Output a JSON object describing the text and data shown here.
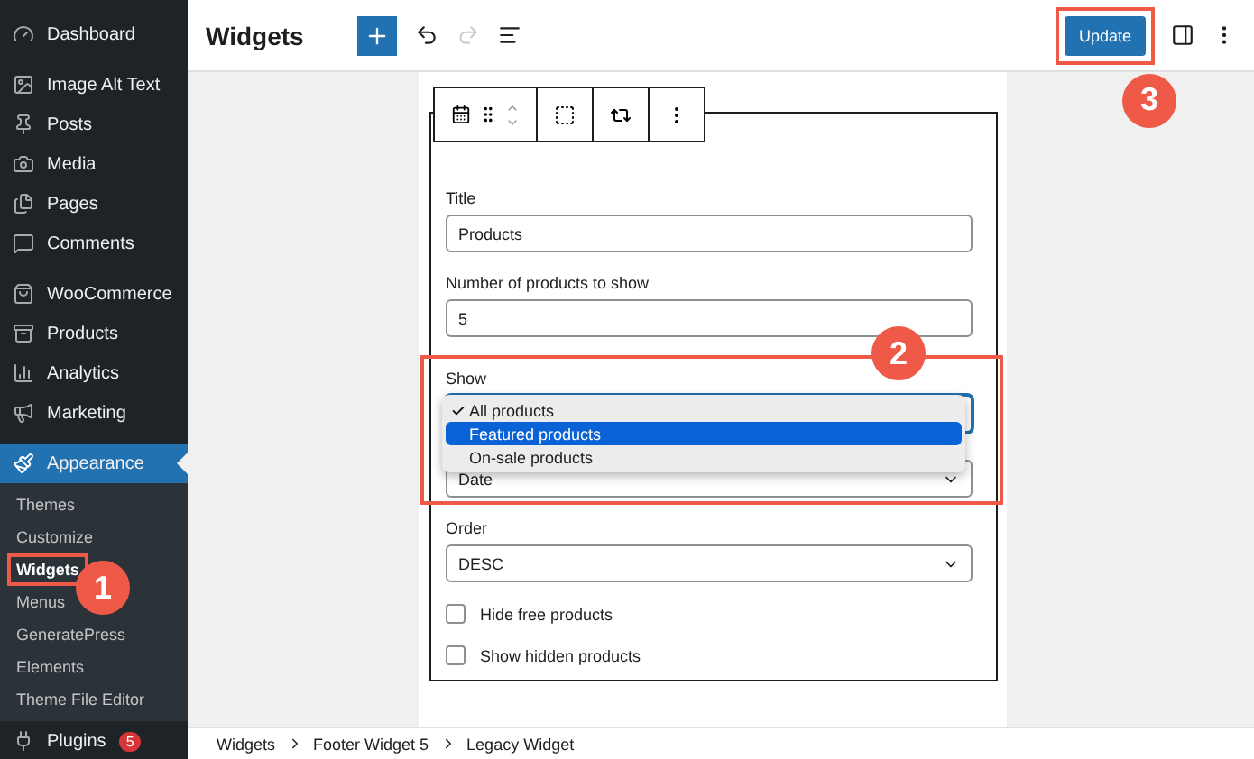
{
  "sidebar": {
    "groups": [
      [
        {
          "label": "Dashboard",
          "selected": false
        }
      ],
      [
        {
          "label": "Image Alt Text",
          "selected": false
        },
        {
          "label": "Posts",
          "selected": false
        },
        {
          "label": "Media",
          "selected": false
        },
        {
          "label": "Pages",
          "selected": false
        },
        {
          "label": "Comments",
          "selected": false
        }
      ],
      [
        {
          "label": "WooCommerce",
          "selected": false
        },
        {
          "label": "Products",
          "selected": false
        },
        {
          "label": "Analytics",
          "selected": false
        },
        {
          "label": "Marketing",
          "selected": false
        }
      ],
      [
        {
          "label": "Appearance",
          "selected": true,
          "children": [
            {
              "label": "Themes",
              "selected": false
            },
            {
              "label": "Customize",
              "selected": false
            },
            {
              "label": "Widgets",
              "selected": true
            },
            {
              "label": "Menus",
              "selected": false
            },
            {
              "label": "GeneratePress",
              "selected": false
            },
            {
              "label": "Elements",
              "selected": false
            },
            {
              "label": "Theme File Editor",
              "selected": false
            }
          ]
        },
        {
          "label": "Plugins",
          "selected": false,
          "badge": "5"
        }
      ]
    ]
  },
  "header": {
    "title": "Widgets",
    "undo_disabled": false,
    "redo_disabled": true,
    "update_button": "Update"
  },
  "widget": {
    "fields": [
      {
        "kind": "text",
        "label": "Title",
        "value": "Products"
      },
      {
        "kind": "text",
        "label": "Number of products to show",
        "value": "5"
      },
      {
        "kind": "select",
        "label": "Show",
        "open": true,
        "options": [
          {
            "label": "All products",
            "checked": true,
            "highlighted": false
          },
          {
            "label": "Featured products",
            "checked": false,
            "highlighted": true
          },
          {
            "label": "On-sale products",
            "checked": false,
            "highlighted": false
          }
        ]
      },
      {
        "kind": "select",
        "value": "Date",
        "open": false
      },
      {
        "kind": "select",
        "label": "Order",
        "value": "DESC",
        "open": false
      },
      {
        "kind": "checkbox",
        "label": "Hide free products",
        "checked": false
      },
      {
        "kind": "checkbox",
        "label": "Show hidden products",
        "checked": false
      }
    ]
  },
  "breadcrumb": [
    "Widgets",
    "Footer Widget 5",
    "Legacy Widget"
  ],
  "callouts": [
    "1",
    "2",
    "3"
  ]
}
